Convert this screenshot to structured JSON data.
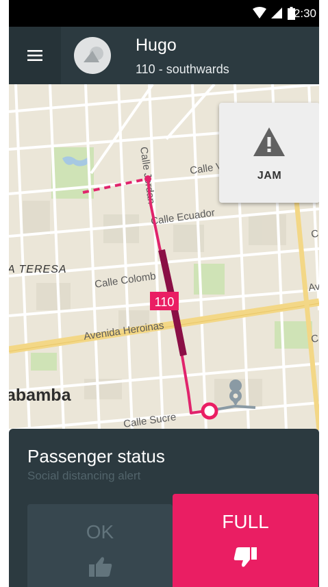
{
  "status_bar": {
    "time": "12:30"
  },
  "header": {
    "name": "Hugo",
    "route": "110 - southwards"
  },
  "map": {
    "streets": [
      "Calle V",
      "Calle Ecuador",
      "Calle Colomb",
      "Avenida Heroinas",
      "Calle Sucre",
      "Calle Jordan"
    ],
    "partial_labels": [
      "A TERESA",
      "abamba",
      "Ave",
      "C",
      "Ca"
    ],
    "bus_label": "110"
  },
  "jam_button": {
    "label": "JAM"
  },
  "passenger_panel": {
    "title": "Passenger status",
    "subtitle": "Social distancing alert",
    "ok_label": "OK",
    "full_label": "FULL"
  },
  "colors": {
    "accent": "#ea1e63",
    "route_dark": "#8a0f45",
    "panel": "#2c3a40",
    "appbar": "#2c3a40"
  }
}
